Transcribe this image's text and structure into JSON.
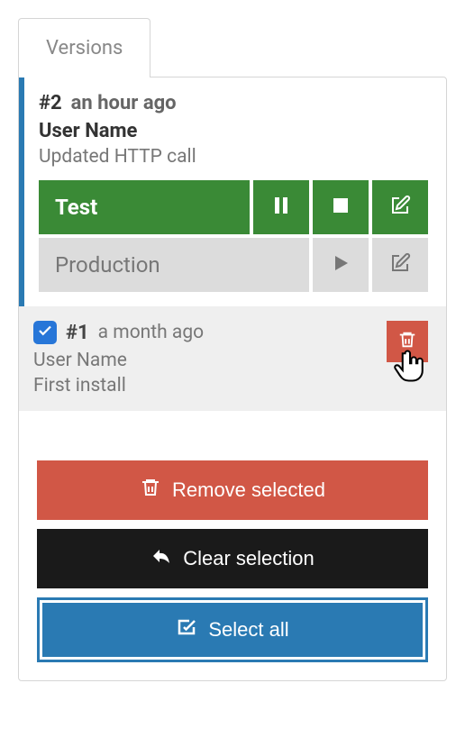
{
  "tab": {
    "label": "Versions"
  },
  "versions": [
    {
      "number": "#2",
      "time": "an hour ago",
      "user": "User Name",
      "desc": "Updated HTTP call",
      "environments": [
        {
          "name": "Test"
        },
        {
          "name": "Production"
        }
      ]
    },
    {
      "number": "#1",
      "time": "a month ago",
      "user": "User Name",
      "desc": "First install"
    }
  ],
  "actions": {
    "remove": "Remove selected",
    "clear": "Clear selection",
    "selectAll": "Select all"
  }
}
